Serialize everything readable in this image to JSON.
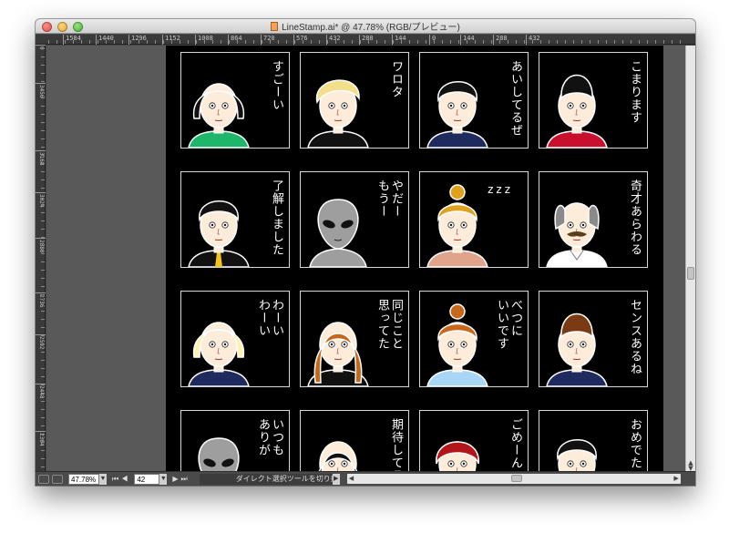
{
  "window": {
    "title": "LineStamp.ai* @ 47.78% (RGB/プレビュー)",
    "controls": [
      "close",
      "minimize",
      "zoom"
    ]
  },
  "ruler": {
    "horizontal": [
      "1584",
      "1440",
      "1296",
      "1152",
      "1008",
      "864",
      "720",
      "576",
      "432",
      "288",
      "144",
      "0",
      "144",
      "288",
      "432"
    ],
    "vertical": [
      "0",
      "3456",
      "3168",
      "3024",
      "2880",
      "2736",
      "2592",
      "2448",
      "2304"
    ]
  },
  "stamps": [
    {
      "caption": "すごーい",
      "face": "woman-bob-black",
      "shirt": "#1db66a",
      "hair": "#111111",
      "skin": "#fdecd9"
    },
    {
      "caption": "ワロタ",
      "face": "man-blond",
      "shirt": "#111111",
      "hair": "#f3df8a",
      "skin": "#fdecd9"
    },
    {
      "caption": "あいしてるぜ",
      "face": "man-pompadour",
      "shirt": "#1f2a5e",
      "hair": "#111111",
      "skin": "#fdecd9"
    },
    {
      "caption": "こまります",
      "face": "man-tall-hair",
      "shirt": "#c8102e",
      "hair": "#111111",
      "skin": "#fdecd9"
    },
    {
      "caption": "了解しました",
      "face": "man-suit-tie",
      "shirt": "#111111",
      "hair": "#111111",
      "skin": "#fdecd9"
    },
    {
      "caption": "やだー\nもうー",
      "face": "alien",
      "shirt": "#9e9e9e",
      "hair": "#9e9e9e",
      "skin": "#9e9e9e"
    },
    {
      "caption": "zzz",
      "face": "woman-bun-sleepy",
      "shirt": "#e0a48d",
      "hair": "#e0a11b",
      "skin": "#fdecd9"
    },
    {
      "caption": "奇才あらわる",
      "face": "scientist",
      "shirt": "#ffffff",
      "hair": "#8a8a8a",
      "skin": "#fdecd9"
    },
    {
      "caption": "わーい\nわーい",
      "face": "woman-bob-blonde",
      "shirt": "#1f2a5e",
      "hair": "#fff2b0",
      "skin": "#fdecd9"
    },
    {
      "caption": "同じこと\n思ってた",
      "face": "woman-long-auburn",
      "shirt": "#111111",
      "hair": "#c8661a",
      "skin": "#fdecd9"
    },
    {
      "caption": "べつに\nいいです",
      "face": "woman-bun-auburn",
      "shirt": "#a9d6f5",
      "hair": "#c8661a",
      "skin": "#fdecd9"
    },
    {
      "caption": "センスあるね",
      "face": "man-tall-brown",
      "shirt": "#1f2a5e",
      "hair": "#7a3b14",
      "skin": "#fdecd9"
    },
    {
      "caption": "いつも\nありが",
      "face": "alien",
      "shirt": "#9e9e9e",
      "hair": "#9e9e9e",
      "skin": "#9e9e9e"
    },
    {
      "caption": "期待してる",
      "face": "woman-black-hair",
      "shirt": "#111111",
      "hair": "#111111",
      "skin": "#fdecd9"
    },
    {
      "caption": "ごめーん",
      "face": "woman-red-hair",
      "shirt": "#c8102e",
      "hair": "#b3161a",
      "skin": "#fdecd9"
    },
    {
      "caption": "おめでたい",
      "face": "man-quiff",
      "shirt": "#111111",
      "hair": "#111111",
      "skin": "#fdecd9"
    }
  ],
  "statusbar": {
    "zoom": "47.78%",
    "page": "42",
    "status_text": "ダイレクト選択ツールを切り換え"
  },
  "colors": {
    "pasteboard": "#595959",
    "artboard": "#000000",
    "chrome": "#474747"
  }
}
